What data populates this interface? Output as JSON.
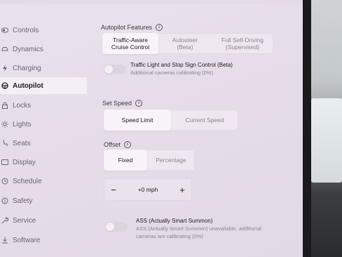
{
  "sidebar": {
    "items": [
      {
        "label": "Controls",
        "icon": "toggle-icon"
      },
      {
        "label": "Dynamics",
        "icon": "car-icon"
      },
      {
        "label": "Charging",
        "icon": "bolt-icon"
      },
      {
        "label": "Autopilot",
        "icon": "steering-wheel-icon"
      },
      {
        "label": "Locks",
        "icon": "lock-icon"
      },
      {
        "label": "Lights",
        "icon": "sun-icon"
      },
      {
        "label": "Seats",
        "icon": "seat-icon"
      },
      {
        "label": "Display",
        "icon": "display-icon"
      },
      {
        "label": "Schedule",
        "icon": "clock-icon"
      },
      {
        "label": "Safety",
        "icon": "info-icon"
      },
      {
        "label": "Service",
        "icon": "wrench-icon"
      },
      {
        "label": "Software",
        "icon": "download-icon"
      }
    ],
    "active": "Autopilot"
  },
  "autopilot_features": {
    "label": "Autopilot Features",
    "options": [
      {
        "line1": "Traffic-Aware",
        "line2": "Cruise Control"
      },
      {
        "line1": "Autosteer",
        "line2": "(Beta)"
      },
      {
        "line1": "Full Self-Driving",
        "line2": "(Supervised)"
      }
    ],
    "selected_index": 0
  },
  "traffic_light": {
    "title": "Traffic Light and Stop Sign Control (Beta)",
    "subtitle": "Additional cameras calibrating (0%)"
  },
  "set_speed": {
    "label": "Set Speed",
    "options": [
      "Speed Limit",
      "Current Speed"
    ],
    "selected_index": 0
  },
  "offset": {
    "label": "Offset",
    "options": [
      "Fixed",
      "Percentage"
    ],
    "selected_index": 0
  },
  "stepper": {
    "minus": "−",
    "value": "+0 mph",
    "plus": "+"
  },
  "ass": {
    "title": "ASS (Actually Smart Summon)",
    "subtitle_line1": "ASS (Actually Smart Summon) unavailable, additional",
    "subtitle_line2": "cameras are calibrating (0%)"
  }
}
